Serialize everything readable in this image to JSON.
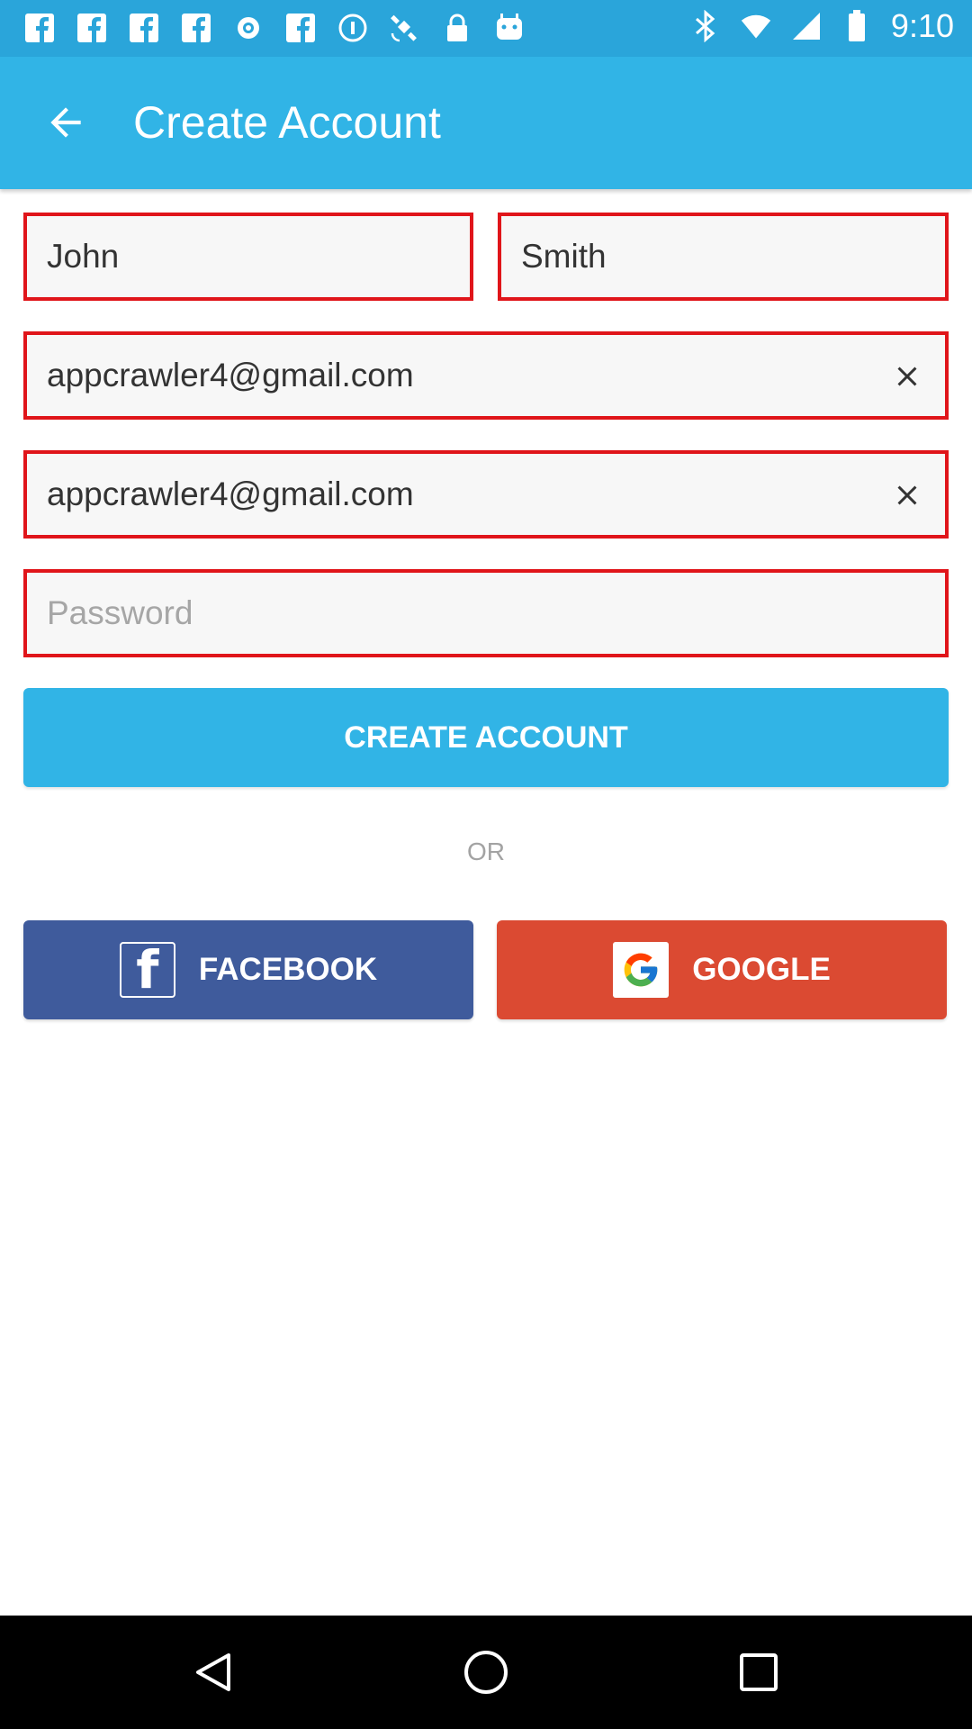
{
  "status_bar": {
    "time": "9:10",
    "left_icons": [
      "facebook-icon",
      "facebook-icon",
      "facebook-icon",
      "facebook-icon",
      "record-icon",
      "facebook-icon",
      "info-icon",
      "satellite-icon",
      "lock-icon",
      "android-icon"
    ],
    "right_icons": [
      "bluetooth-icon",
      "wifi-icon",
      "signal-icon",
      "battery-icon"
    ]
  },
  "app_bar": {
    "title": "Create Account",
    "back_icon": "arrow-back-icon"
  },
  "form": {
    "first_name": {
      "value": "John",
      "placeholder": ""
    },
    "last_name": {
      "value": "Smith",
      "placeholder": ""
    },
    "email": {
      "value": "appcrawler4@gmail.com",
      "placeholder": ""
    },
    "confirm_email": {
      "value": "appcrawler4@gmail.com",
      "placeholder": ""
    },
    "password": {
      "value": "",
      "placeholder": "Password"
    }
  },
  "create_button": {
    "label": "CREATE ACCOUNT"
  },
  "separator": {
    "label": "OR"
  },
  "social": {
    "facebook": {
      "label": "FACEBOOK",
      "logo": "f"
    },
    "google": {
      "label": "GOOGLE"
    }
  },
  "colors": {
    "primary": "#31b4e6",
    "status_bar": "#2aa5da",
    "error_border": "#e0151a",
    "facebook": "#3f5b9c",
    "google": "#db4a32"
  }
}
